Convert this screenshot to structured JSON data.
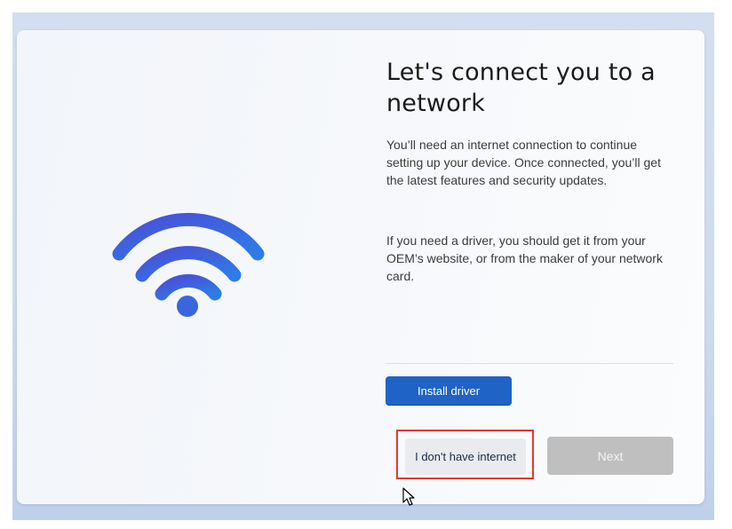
{
  "setup": {
    "title": "Let's connect you to a network",
    "paragraphs": [
      "You’ll need an internet connection to continue setting up your device. Once connected, you’ll get the latest features and security updates.",
      "If you need a driver, you should get it from your OEM’s website, or from the maker of your network card."
    ],
    "buttons": {
      "install_driver": "Install driver",
      "no_internet": "I don't have internet",
      "next": "Next"
    },
    "illustration": "wifi-icon",
    "pointer": "mouse-cursor-icon"
  },
  "colors": {
    "accent": "#1f63c6",
    "wifi_gradient_start": "#4a50d6",
    "wifi_gradient_end": "#2f7fe6",
    "highlight": "#e03a2f",
    "disabled": "#bfbfbf"
  }
}
